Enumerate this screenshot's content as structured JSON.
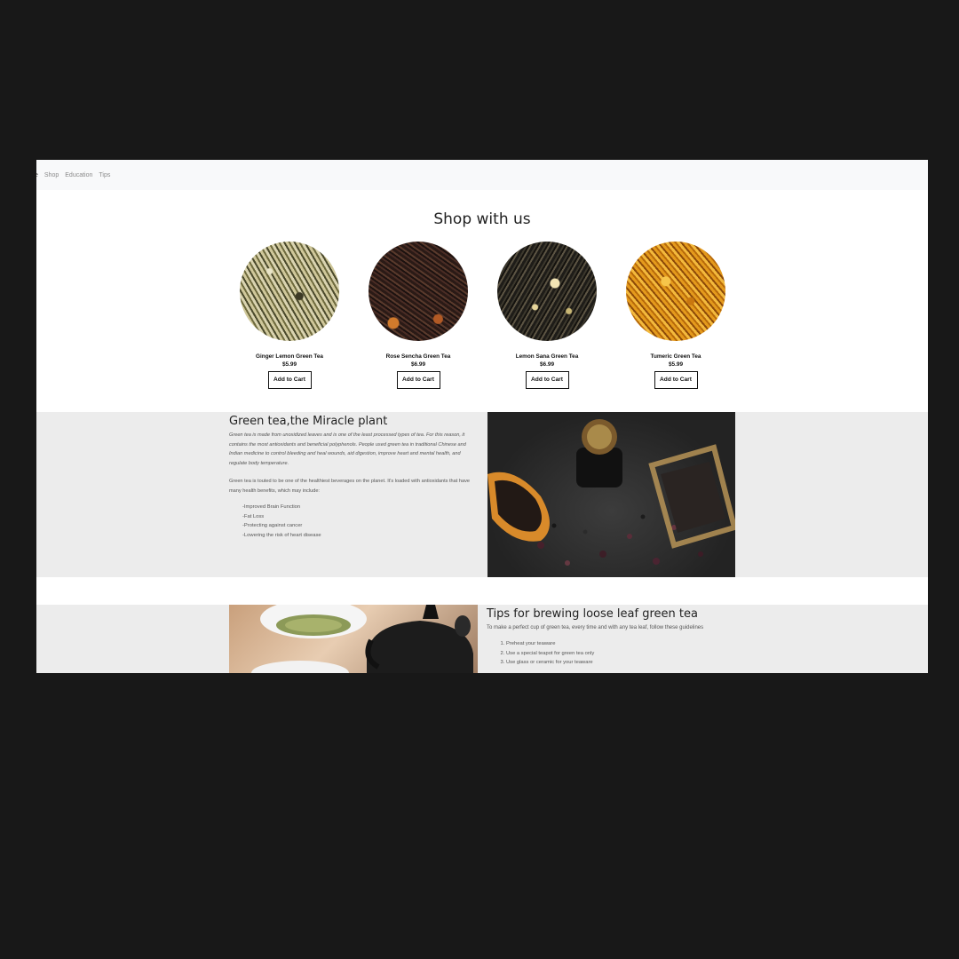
{
  "nav": {
    "items": [
      {
        "label": "e"
      },
      {
        "label": "Shop"
      },
      {
        "label": "Education"
      },
      {
        "label": "Tips"
      }
    ]
  },
  "shop": {
    "title": "Shop with us",
    "products": [
      {
        "name": "Ginger Lemon Green Tea",
        "price": "$5.99",
        "button": "Add to Cart"
      },
      {
        "name": "Rose Sencha Green Tea",
        "price": "$6.99",
        "button": "Add to Cart"
      },
      {
        "name": "Lemon Sana Green Tea",
        "price": "$6.99",
        "button": "Add to Cart"
      },
      {
        "name": "Tumeric Green Tea",
        "price": "$5.99",
        "button": "Add to Cart"
      }
    ]
  },
  "education": {
    "title": "Green tea,the Miracle plant",
    "intro": "Green tea is made from unoxidized leaves and is one of the least processed types of tea. For this reason, it contains the most antioxidants and beneficial polyphenols. People used green tea in traditional Chinese and Indian medicine to control bleeding and heal wounds, aid digestion, improve heart and mental health, and regulate body temperature.",
    "paragraph": "Green tea is touted to be one of the healthiest beverages on the planet. It's loaded with antioxidants that have many health benefits, which may include:",
    "benefits": [
      "-Improved Brain Function",
      "-Fat Loss",
      "-Protecting against cancer",
      "-Lowering the risk of heart disease"
    ]
  },
  "tips": {
    "title": "Tips for brewing loose leaf green tea",
    "intro": "To make a perfect cup of green tea, every time and with any tea leaf, follow these guidelines",
    "steps": [
      "Preheat your teaware",
      "Use a special teapot for green tea only",
      "Use glass or ceramic for your teaware"
    ]
  }
}
